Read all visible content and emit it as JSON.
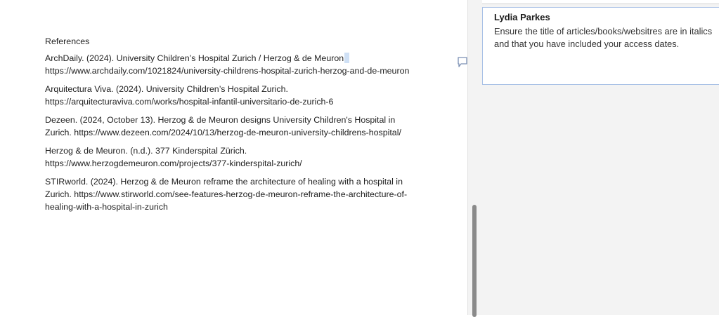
{
  "document": {
    "heading": "References",
    "references": [
      "ArchDaily. (2024). University Children’s Hospital Zurich / Herzog & de Meuron.",
      "https://www.archdaily.com/1021824/university-childrens-hospital-zurich-herzog-and-de-meuron",
      "Arquitectura Viva. (2024). University Children’s Hospital Zurich. https://arquitecturaviva.com/works/hospital-infantil-universitario-de-zurich-6",
      "Dezeen. (2024, October 13). Herzog & de Meuron designs University Children's Hospital in Zurich. https://www.dezeen.com/2024/10/13/herzog-de-meuron-university-childrens-hospital/",
      "Herzog & de Meuron. (n.d.). 377 Kinderspital Zürich. https://www.herzogdemeuron.com/projects/377-kinderspital-zurich/",
      "STIRworld. (2024). Herzog & de Meuron reframe the architecture of healing with a hospital in Zurich. https://www.stirworld.com/see-features-herzog-de-meuron-reframe-the-architecture-of-healing-with-a-hospital-in-zurich"
    ]
  },
  "comment": {
    "author": "Lydia Parkes",
    "text": "Ensure the title of articles/books/websitres are in italics and that you have included your access dates."
  },
  "icons": {
    "comment_marker": "comment-icon"
  },
  "colors": {
    "comment_card_border": "#a9c1e6",
    "pane_background": "#f3f3f3",
    "selection_highlight": "#cfe0f5"
  }
}
